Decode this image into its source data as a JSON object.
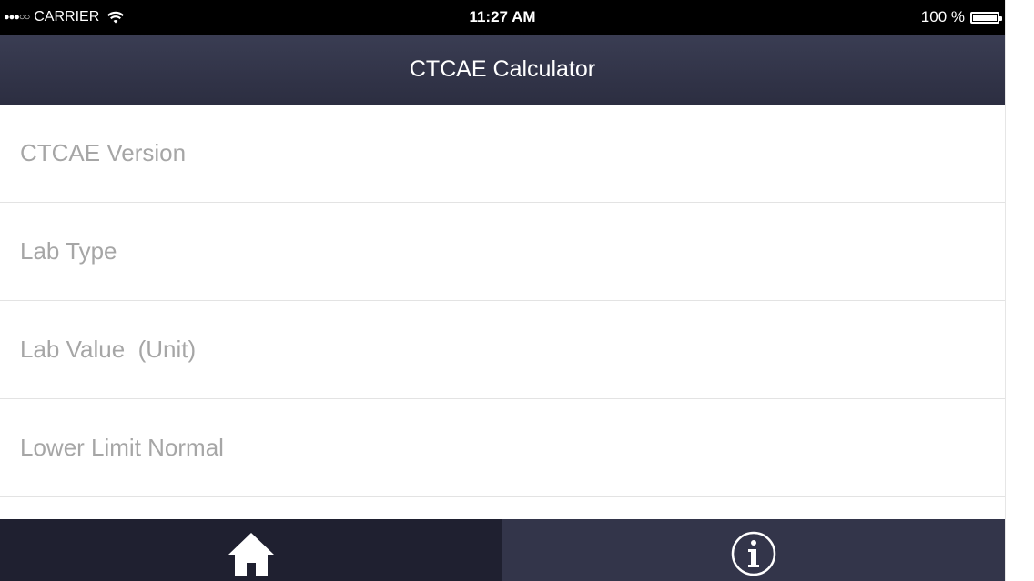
{
  "status_bar": {
    "signal": "●●●○○",
    "carrier": "CARRIER",
    "time": "11:27 AM",
    "battery_percent": "100 %",
    "battery_level": 1.0,
    "icons": [
      "signal-dots-icon",
      "wifi-icon",
      "battery-icon"
    ]
  },
  "nav": {
    "title": "CTCAE Calculator"
  },
  "form": {
    "fields": [
      {
        "placeholder": "CTCAE Version"
      },
      {
        "placeholder": "Lab Type"
      },
      {
        "placeholder": "Lab Value  (Unit)"
      },
      {
        "placeholder": "Lower Limit Normal"
      }
    ]
  },
  "tab_bar": {
    "tabs": [
      {
        "icon": "home-icon",
        "selected": true
      },
      {
        "icon": "info-icon",
        "selected": false
      }
    ]
  },
  "colors": {
    "status_bar_bg": "#000000",
    "nav_bg": "#33354a",
    "tab_selected_bg": "#1f2030",
    "tab_bg": "#33354a",
    "placeholder_text": "#a6a6a6",
    "separator": "#e3e3e3"
  }
}
